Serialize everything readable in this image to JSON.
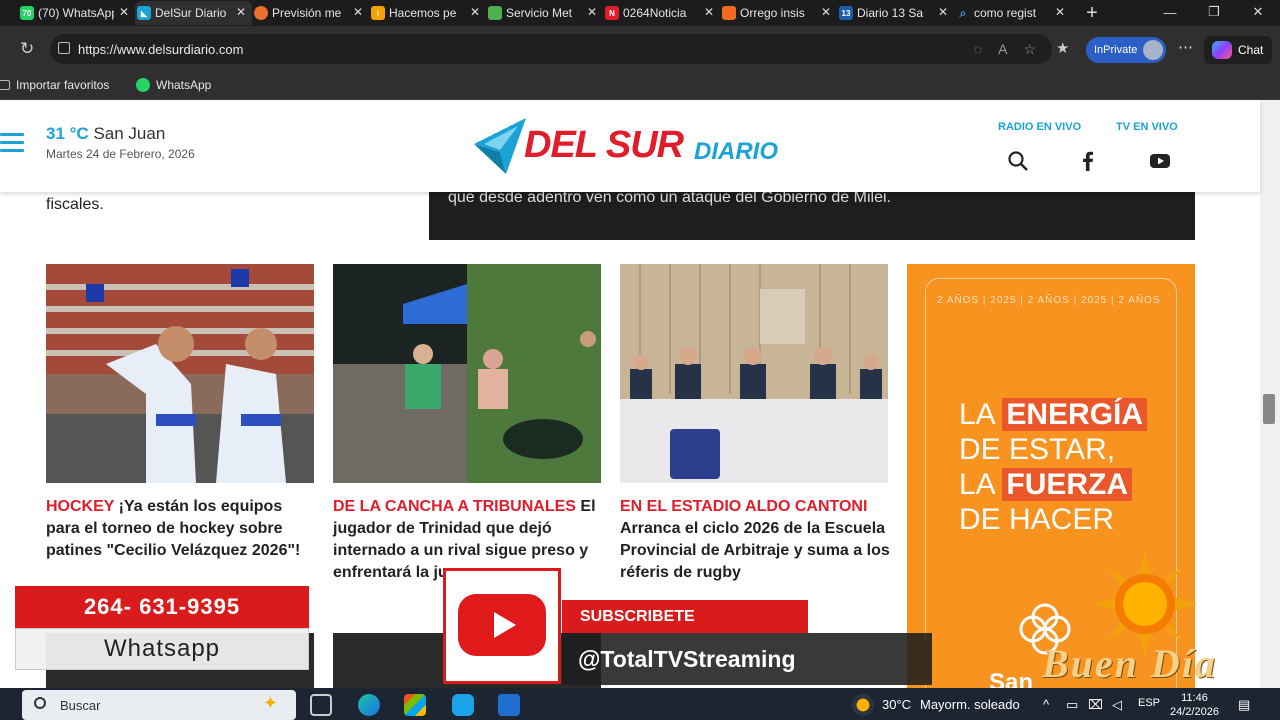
{
  "browser": {
    "tabs": [
      {
        "title": "(70) WhatsApp",
        "badge": "70",
        "color": "#25d366",
        "active": false
      },
      {
        "title": "DelSur Diario",
        "color": "#1ba3d6",
        "active": true
      },
      {
        "title": "Previsión me",
        "color": "#e8702a",
        "active": false
      },
      {
        "title": "Hacemos pe",
        "color": "#f4a300",
        "active": false
      },
      {
        "title": "Servicio Met",
        "color": "#4caf50",
        "active": false
      },
      {
        "title": "0264Noticia",
        "badge": "N",
        "color": "#e11d2b",
        "active": false
      },
      {
        "title": "Orrego insis",
        "color": "#f26b21",
        "active": false
      },
      {
        "title": "Diario 13 Sa",
        "badge": "13",
        "color": "#1d5fa8",
        "active": false
      },
      {
        "title": "como regist",
        "color": "#4a90e2",
        "active": false
      }
    ],
    "new_tab": "+",
    "url": "https://www.delsurdiario.com",
    "inprivate": "InPrivate",
    "chat": "Chat",
    "favorites": [
      {
        "label": "Importar favoritos"
      },
      {
        "label": "WhatsApp"
      }
    ]
  },
  "header": {
    "temp": "31 °C",
    "city": "San Juan",
    "date": "Martes 24 de Febrero, 2026",
    "logo_main": "DEL SUR",
    "logo_sub": "DIARIO",
    "radio": "RADIO EN VIVO",
    "tv": "TV EN VIVO"
  },
  "content": {
    "prev_text": "fiscales.",
    "banner_text": "que desde adentro ven como un ataque del Gobierno de Milei.",
    "cards": [
      {
        "kicker": "HOCKEY",
        "headline": "¡Ya están los equipos para el torneo de hockey sobre patines \"Cecilio Velázquez 2026\"!"
      },
      {
        "kicker": "DE LA CANCHA A TRIBUNALES",
        "headline": "El jugador de Trinidad que dejó internado a un rival sigue preso y enfrentará la ju"
      },
      {
        "kicker": "EN EL ESTADIO ALDO CANTONI",
        "headline": "Arranca el ciclo 2026 de la Escuela Provincial de Arbitraje y suma a los réferis de rugby"
      }
    ],
    "ad": {
      "ring_text": "2 AÑOS | 2025 | 2 AÑOS | 2025 | 2 AÑOS",
      "line1_a": "LA ",
      "line1_b": "ENERGÍA",
      "line2": "DE ESTAR,",
      "line3_a": "LA ",
      "line3_b": "FUERZA",
      "line4": "DE HACER",
      "brand": "San"
    }
  },
  "overlay": {
    "phone": "264- 631-9395",
    "whatsapp": "Whatsapp",
    "subscribe": "SUBSCRIBETE",
    "handle": "@TotalTVStreaming",
    "buen_dia": "Buen Día"
  },
  "taskbar": {
    "search": "Buscar",
    "weather": "30°C",
    "weather_desc": "Mayorm. soleado",
    "lang": "ESP",
    "time": "11:46",
    "date": "24/2/2026"
  },
  "colors": {
    "accent_blue": "#1ba3d6",
    "brand_red": "#e11d2b",
    "ad_orange": "#f7931e"
  }
}
